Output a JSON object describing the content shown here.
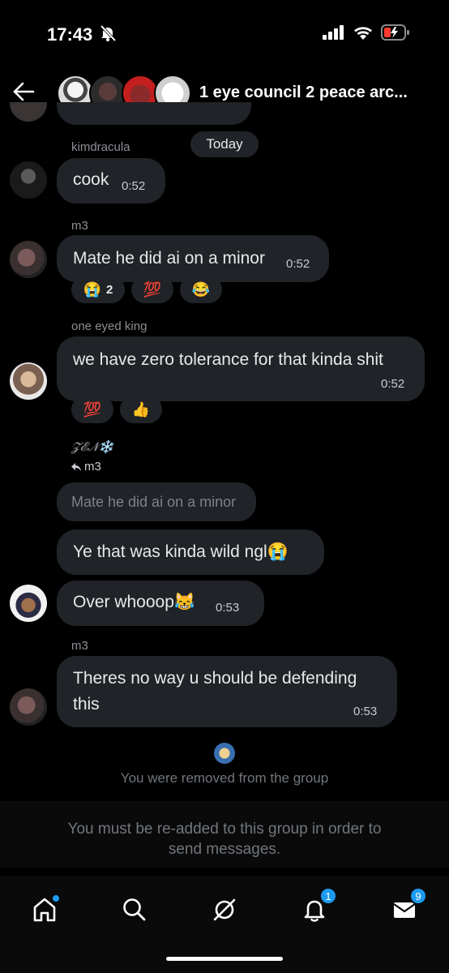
{
  "status_bar": {
    "time": "17:43"
  },
  "header": {
    "title": "1 eye council 2 peace arc..."
  },
  "today_label": "Today",
  "messages": [
    {
      "sender": "kimdracula",
      "text": "cook",
      "time": "0:52"
    },
    {
      "sender": "m3",
      "text": "Mate he did ai on a minor",
      "time": "0:52",
      "reactions": [
        {
          "emoji": "😭",
          "count": "2"
        },
        {
          "emoji": "💯",
          "count": ""
        },
        {
          "emoji": "😂",
          "count": ""
        }
      ]
    },
    {
      "sender": "one eyed king",
      "text": "we have zero tolerance for that kinda shit",
      "time": "0:52",
      "reactions": [
        {
          "emoji": "💯",
          "count": ""
        },
        {
          "emoji": "👍",
          "count": ""
        }
      ]
    },
    {
      "sender": "𝓩𝓔𝓝❄️",
      "reply_to": "m3",
      "quoted": "Mate he did ai on a minor",
      "texts": [
        "Ye that was kinda wild ngl😭",
        "Over whooop😹"
      ],
      "time": "0:53"
    },
    {
      "sender": "m3",
      "text_line1": "Theres no way u should be defending",
      "text_line2": "this",
      "time": "0:53"
    }
  ],
  "system_message": "You were removed from the group",
  "compose_note_line1": "You must be re-added to this group in order to",
  "compose_note_line2": "send messages.",
  "tabbar": {
    "notifications_badge": "1",
    "messages_badge": "9"
  }
}
